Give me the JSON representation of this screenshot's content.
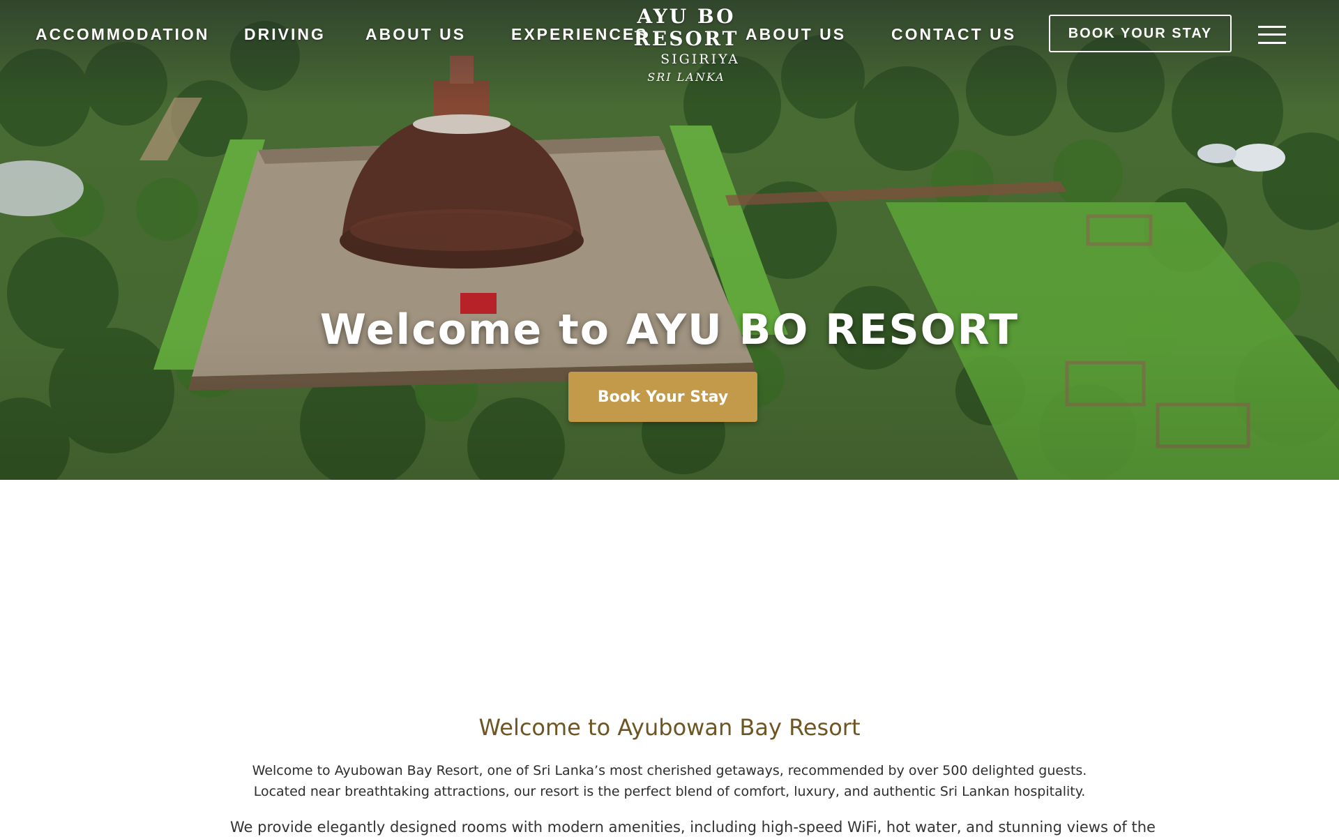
{
  "nav": {
    "links": [
      "ACCOMMODATION",
      "DRIVING",
      "ABOUT  US",
      "EXPERIENCES",
      "ABOUT  US",
      "CONTACT US"
    ],
    "cta_label": "BOOK YOUR STAY"
  },
  "brand": {
    "name": "AYU BO RESORT",
    "place": "SIGIRIYA",
    "country": "SRI LANKA"
  },
  "hero": {
    "title": "Welcome to AYU BO RESORT",
    "button_label": "Book Your Stay"
  },
  "intro": {
    "title": "Welcome to Ayubowan Bay Resort",
    "paragraph_1": "Welcome to Ayubowan Bay Resort, one of Sri Lanka’s most cherished getaways, recommended by over 500 delighted guests. Located near breathtaking attractions, our resort is the perfect blend of comfort, luxury, and authentic Sri Lankan hospitality.",
    "paragraph_2": "We provide elegantly designed rooms with modern amenities, including high-speed WiFi, hot water, and stunning views of the"
  },
  "colors": {
    "gold_button": "#c29a4a",
    "heading_brown": "#6e5524",
    "lawn_green": "#5fa83a",
    "stupa_brown": "#5a3125"
  },
  "icons": {
    "menu": "hamburger-menu-icon"
  }
}
